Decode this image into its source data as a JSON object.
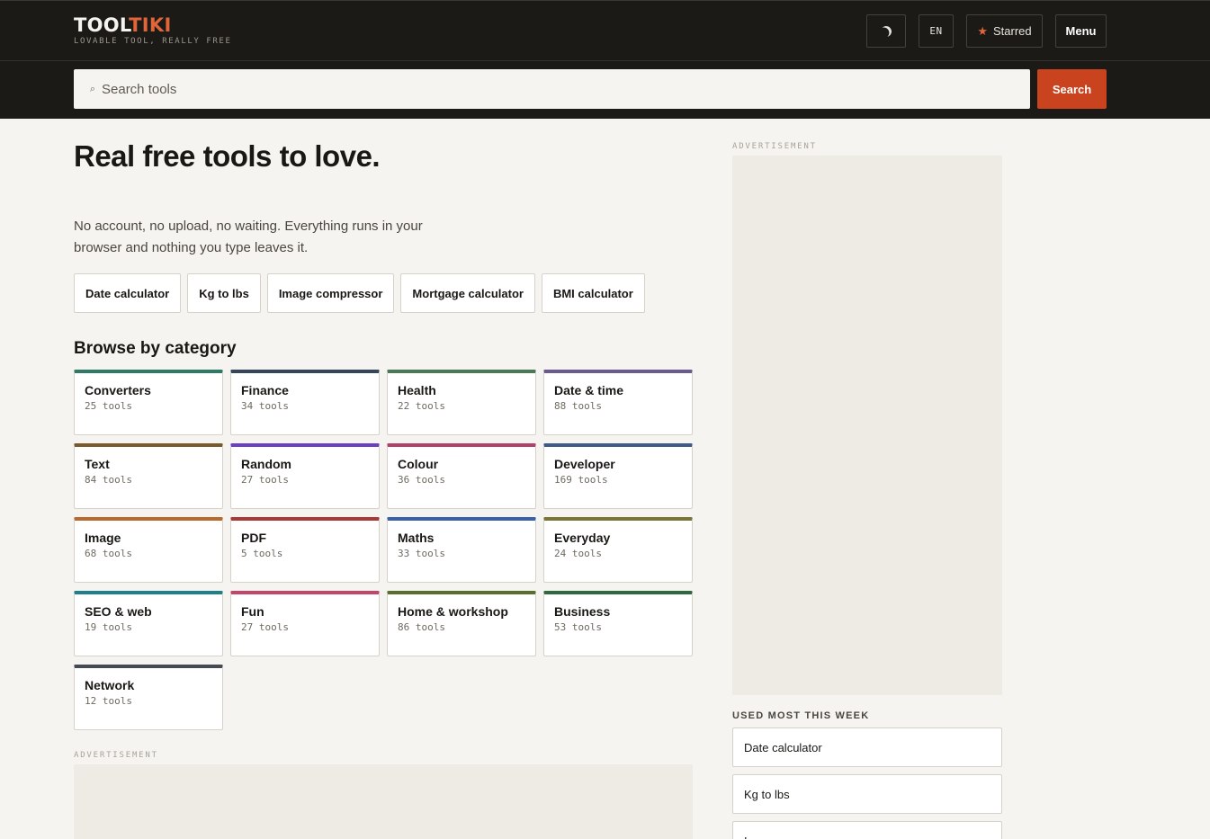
{
  "header": {
    "logo_part1": "TOOL",
    "logo_part2": "TIKI",
    "tagline": "LOVABLE TOOL, REALLY FREE",
    "theme_icon": "moon-icon",
    "lang_label": "EN",
    "starred_icon": "star-icon",
    "starred_label": "Starred",
    "menu_label": "Menu"
  },
  "search": {
    "icon": "search-icon",
    "placeholder": "Search tools",
    "value": "",
    "button_label": "Search"
  },
  "hero": {
    "title": "Real free tools to love.",
    "subtitle": "No account, no upload, no waiting. Everything runs in your browser and nothing you type leaves it."
  },
  "quick_links": [
    "Date calculator",
    "Kg to lbs",
    "Image compressor",
    "Mortgage calculator",
    "BMI calculator"
  ],
  "browse": {
    "title": "Browse by category",
    "categories": [
      {
        "name": "Converters",
        "count": "25 tools",
        "color": "#2f7a64"
      },
      {
        "name": "Finance",
        "count": "34 tools",
        "color": "#34465a"
      },
      {
        "name": "Health",
        "count": "22 tools",
        "color": "#4a7a55"
      },
      {
        "name": "Date & time",
        "count": "88 tools",
        "color": "#6b5a8e"
      },
      {
        "name": "Text",
        "count": "84 tools",
        "color": "#7a5a2a"
      },
      {
        "name": "Random",
        "count": "27 tools",
        "color": "#6b3fc4"
      },
      {
        "name": "Colour",
        "count": "36 tools",
        "color": "#b0416a"
      },
      {
        "name": "Developer",
        "count": "169 tools",
        "color": "#3e5a8a"
      },
      {
        "name": "Image",
        "count": "68 tools",
        "color": "#b86a2e"
      },
      {
        "name": "PDF",
        "count": "5 tools",
        "color": "#a83a36"
      },
      {
        "name": "Maths",
        "count": "33 tools",
        "color": "#3a62a8"
      },
      {
        "name": "Everyday",
        "count": "24 tools",
        "color": "#7a7436"
      },
      {
        "name": "SEO & web",
        "count": "19 tools",
        "color": "#1f7f8a"
      },
      {
        "name": "Fun",
        "count": "27 tools",
        "color": "#c4456a"
      },
      {
        "name": "Home & workshop",
        "count": "86 tools",
        "color": "#5a6e2e"
      },
      {
        "name": "Business",
        "count": "53 tools",
        "color": "#2f6a3e"
      },
      {
        "name": "Network",
        "count": "12 tools",
        "color": "#454a52"
      }
    ]
  },
  "ads": {
    "side_label": "ADVERTISEMENT",
    "bottom_label": "ADVERTISEMENT"
  },
  "used_most": {
    "title": "USED MOST THIS WEEK",
    "items": [
      "Date calculator",
      "Kg to lbs",
      "Image compressor"
    ]
  }
}
